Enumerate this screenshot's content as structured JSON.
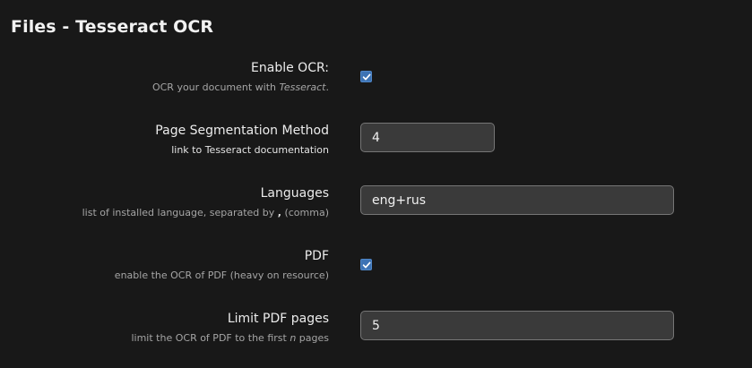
{
  "section": {
    "title": "Files - Tesseract OCR"
  },
  "fields": {
    "enable_ocr": {
      "label": "Enable OCR:",
      "hint_prefix": "OCR your document with ",
      "hint_emph": "Tesseract",
      "hint_suffix": ".",
      "checked": true
    },
    "psm": {
      "label": "Page Segmentation Method",
      "hint": "link to Tesseract documentation",
      "value": "4"
    },
    "languages": {
      "label": "Languages",
      "hint_prefix": "list of installed language, separated by ",
      "hint_bold": ",",
      "hint_suffix": " (comma)",
      "value": "eng+rus"
    },
    "pdf": {
      "label": "PDF",
      "hint": "enable the OCR of PDF (heavy on resource)",
      "checked": true
    },
    "limit_pdf_pages": {
      "label": "Limit PDF pages",
      "hint_prefix": "limit the OCR of PDF to the first ",
      "hint_emph": "n",
      "hint_suffix": " pages",
      "value": "5"
    }
  },
  "colors": {
    "background": "#181818",
    "checkbox_accent": "#3d73b4",
    "input_background": "#3a3a3a",
    "input_border": "#767676"
  },
  "icons": {
    "checkbox_check": "checkmark-icon"
  }
}
